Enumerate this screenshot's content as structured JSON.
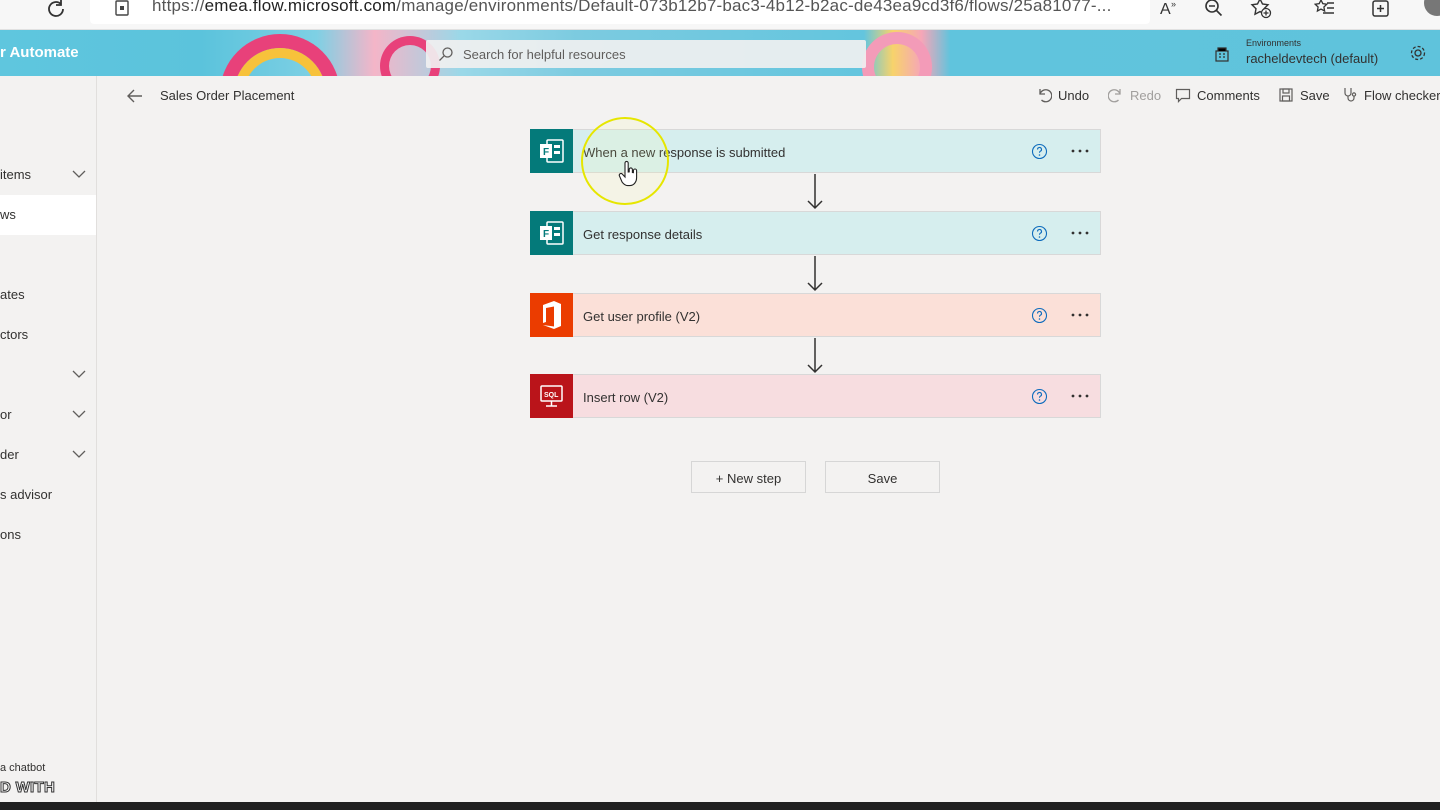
{
  "browser": {
    "url_prefix": "https://",
    "url_host": "emea.flow.microsoft.com",
    "url_path": "/manage/environments/Default-073b12b7-bac3-4b12-b2ac-de43ea9cd3f6/flows/25a81077-..."
  },
  "header": {
    "app_title": "r Automate",
    "search_placeholder": "Search for helpful resources",
    "env_label": "Environments",
    "env_name": "racheldevtech (default)"
  },
  "nav": {
    "items": [
      {
        "label": "items"
      },
      {
        "label": "ws"
      },
      {
        "label": "ates"
      },
      {
        "label": "ctors"
      },
      {
        "label": ""
      },
      {
        "label": "or"
      },
      {
        "label": "der"
      },
      {
        "label": "s advisor"
      },
      {
        "label": "ons"
      }
    ],
    "footer": "a chatbot",
    "footer2": "D WITH"
  },
  "commandbar": {
    "flow_name": "Sales Order Placement",
    "undo": "Undo",
    "redo": "Redo",
    "comments": "Comments",
    "save": "Save",
    "flow_checker": "Flow checker"
  },
  "steps": [
    {
      "title": "When a new response is submitted",
      "connector": "forms-icon"
    },
    {
      "title": "Get response details",
      "connector": "forms-icon"
    },
    {
      "title": "Get user profile (V2)",
      "connector": "office365-icon"
    },
    {
      "title": "Insert row (V2)",
      "connector": "sql-server-icon"
    }
  ],
  "actions": {
    "new_step": "+ New step",
    "save": "Save"
  },
  "colors": {
    "forms": "#047a7a",
    "office": "#eb3c00",
    "sql": "#ba141a",
    "forms_bg": "#d6eeee",
    "office_bg": "#fbe0d8",
    "sql_bg": "#f7dde0"
  }
}
